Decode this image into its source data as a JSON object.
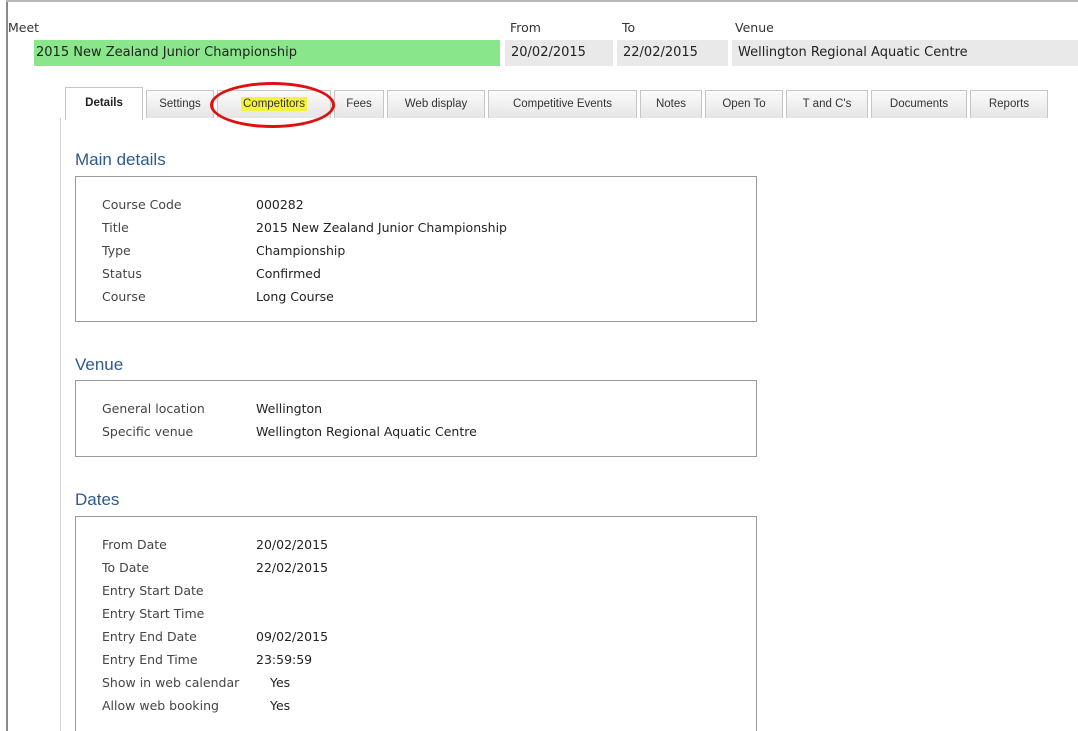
{
  "header": {
    "meet_label": "Meet",
    "from_label": "From",
    "to_label": "To",
    "venue_label": "Venue",
    "meet_value": "2015 New Zealand Junior Championship",
    "from_value": "20/02/2015",
    "to_value": "22/02/2015",
    "venue_value": "Wellington Regional Aquatic Centre",
    "meet_highlight_color": "#8ae68a"
  },
  "tabs": [
    {
      "label": "Details",
      "active": true
    },
    {
      "label": "Settings"
    },
    {
      "label": "Competitors",
      "highlighted": true
    },
    {
      "label": "Fees"
    },
    {
      "label": "Web display"
    },
    {
      "label": "Competitive Events"
    },
    {
      "label": "Notes"
    },
    {
      "label": "Open To"
    },
    {
      "label": "T and C's"
    },
    {
      "label": "Documents"
    },
    {
      "label": "Reports"
    }
  ],
  "main_details": {
    "title": "Main details",
    "rows": [
      {
        "label": "Course Code",
        "value": "000282"
      },
      {
        "label": "Title",
        "value": "2015 New Zealand Junior Championship"
      },
      {
        "label": "Type",
        "value": "Championship"
      },
      {
        "label": "Status",
        "value": "Confirmed"
      },
      {
        "label": "Course",
        "value": "Long Course"
      }
    ]
  },
  "venue": {
    "title": "Venue",
    "rows": [
      {
        "label": "General location",
        "value": "Wellington"
      },
      {
        "label": "Specific venue",
        "value": "Wellington Regional Aquatic Centre"
      }
    ]
  },
  "dates": {
    "title": "Dates",
    "rows": [
      {
        "label": "From Date",
        "value": "20/02/2015"
      },
      {
        "label": "To Date",
        "value": "22/02/2015"
      },
      {
        "label": "Entry Start Date",
        "value": ""
      },
      {
        "label": "Entry Start Time",
        "value": ""
      },
      {
        "label": "Entry End Date",
        "value": "09/02/2015"
      },
      {
        "label": "Entry End Time",
        "value": "23:59:59"
      },
      {
        "label": "Show in web calendar",
        "value": "Yes"
      },
      {
        "label": "Allow web booking",
        "value": "Yes"
      }
    ]
  },
  "colors": {
    "section_title": "#2f5a8c",
    "tab_highlight": "#f4f23e",
    "annotation_circle": "#e01010"
  }
}
